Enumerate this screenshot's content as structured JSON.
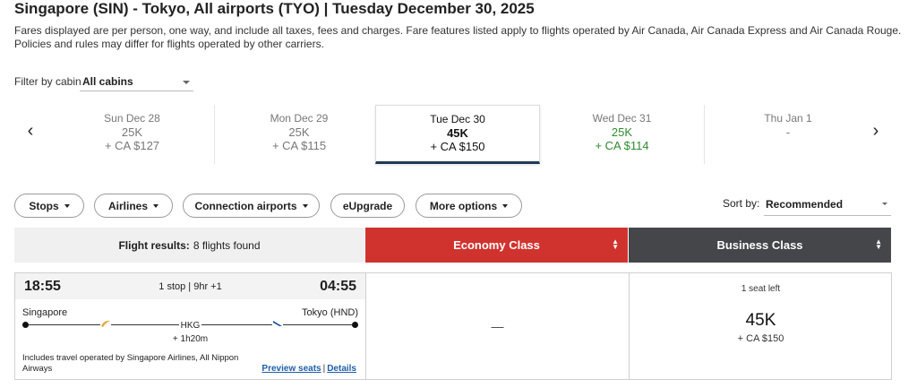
{
  "header": {
    "title": "Singapore (SIN) - Tokyo, All airports (TYO)  |  Tuesday December 30, 2025",
    "disclaimer": "Fares displayed are per person, one way, and include all taxes, fees and charges. Fare features listed apply to flights operated by Air Canada, Air Canada Express and Air Canada Rouge. Policies and rules may differ for flights operated by other carriers."
  },
  "cabin_filter": {
    "label": "Filter by cabin",
    "value": "All cabins"
  },
  "date_strip": {
    "prev_icon": "chevron-left-icon",
    "next_icon": "chevron-right-icon",
    "dates": [
      {
        "label": "Sun Dec 28",
        "points": "25K",
        "cash": "+ CA $127"
      },
      {
        "label": "Mon Dec 29",
        "points": "25K",
        "cash": "+ CA $115"
      },
      {
        "label": "Tue Dec 30",
        "points": "45K",
        "cash": "+ CA $150",
        "selected": true
      },
      {
        "label": "Wed Dec 31",
        "points": "25K",
        "cash": "+ CA $114",
        "lowest": true,
        "color": "#2e8b2e"
      },
      {
        "label": "Thu Jan 1",
        "points": "-",
        "cash": ""
      }
    ]
  },
  "filters": {
    "stops": "Stops",
    "airlines": "Airlines",
    "connection_airports": "Connection airports",
    "eupgrade": "eUpgrade",
    "more_options": "More options"
  },
  "sort": {
    "label": "Sort by:",
    "value": "Recommended"
  },
  "results": {
    "label": "Flight results:",
    "count": "8 flights found",
    "economy_header": "Economy Class",
    "business_header": "Business Class",
    "economy_color": "#d0332e",
    "business_color": "#444649"
  },
  "flight": {
    "departure_time": "18:55",
    "arrival_time": "04:55",
    "stops_duration": "1 stop | 9hr +1",
    "origin": "Singapore",
    "destination": "Tokyo (HND)",
    "connection": "HKG",
    "layover": "+ 1h20m",
    "operated_by": "Includes travel operated by Singapore Airlines, All Nippon Airways",
    "preview_seats": "Preview seats",
    "details": "Details",
    "link_separator": "|",
    "economy_fare": "—",
    "business_seats_left": "1 seat left",
    "business_points": "45K",
    "business_cash": "+ CA $150"
  }
}
